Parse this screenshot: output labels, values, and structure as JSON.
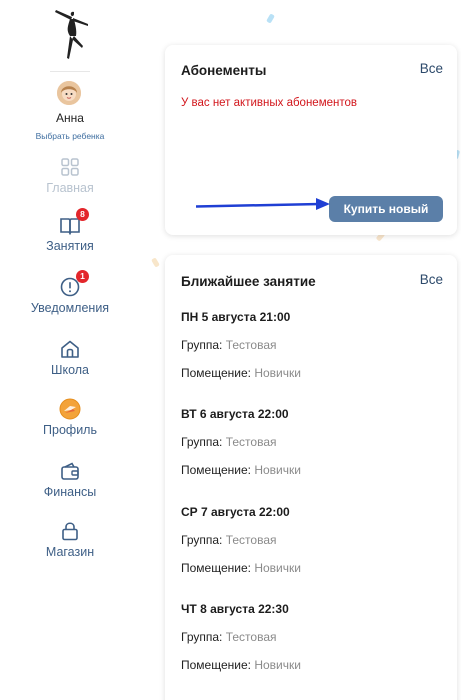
{
  "profile": {
    "name": "Анна",
    "choose_child": "Выбрать ребенка"
  },
  "nav": [
    {
      "id": "home",
      "label": "Главная",
      "icon": "grid-icon",
      "badge": null,
      "disabled": true
    },
    {
      "id": "lessons",
      "label": "Занятия",
      "icon": "book-icon",
      "badge": "8",
      "disabled": false
    },
    {
      "id": "notifications",
      "label": "Уведомления",
      "icon": "alert-icon",
      "badge": "1",
      "disabled": false
    },
    {
      "id": "school",
      "label": "Школа",
      "icon": "house-icon",
      "badge": null,
      "disabled": false
    },
    {
      "id": "profile",
      "label": "Профиль",
      "icon": "profile-avatar-icon",
      "badge": null,
      "disabled": false
    },
    {
      "id": "finance",
      "label": "Финансы",
      "icon": "wallet-icon",
      "badge": null,
      "disabled": false
    },
    {
      "id": "shop",
      "label": "Магазин",
      "icon": "lock-icon",
      "badge": null,
      "disabled": false
    }
  ],
  "subscriptions": {
    "title": "Абонементы",
    "all_label": "Все",
    "empty_message": "У вас нет активных абонементов",
    "buy_label": "Купить новый"
  },
  "upcoming": {
    "title": "Ближайшее занятие",
    "all_label": "Все",
    "group_label": "Группа:",
    "room_label": "Помещение:",
    "sessions": [
      {
        "date": "ПН 5 августа 21:00",
        "group": "Тестовая",
        "room": "Новички"
      },
      {
        "date": "ВТ 6 августа 22:00",
        "group": "Тестовая",
        "room": "Новички"
      },
      {
        "date": "СР 7 августа 22:00",
        "group": "Тестовая",
        "room": "Новички"
      },
      {
        "date": "ЧТ 8 августа 22:30",
        "group": "Тестовая",
        "room": "Новички"
      }
    ]
  },
  "colors": {
    "accent": "#5b7fa8",
    "nav_text": "#3e5f86",
    "badge": "#e3262b",
    "error_text": "#d2161c",
    "arrow": "#1f3fd4"
  }
}
